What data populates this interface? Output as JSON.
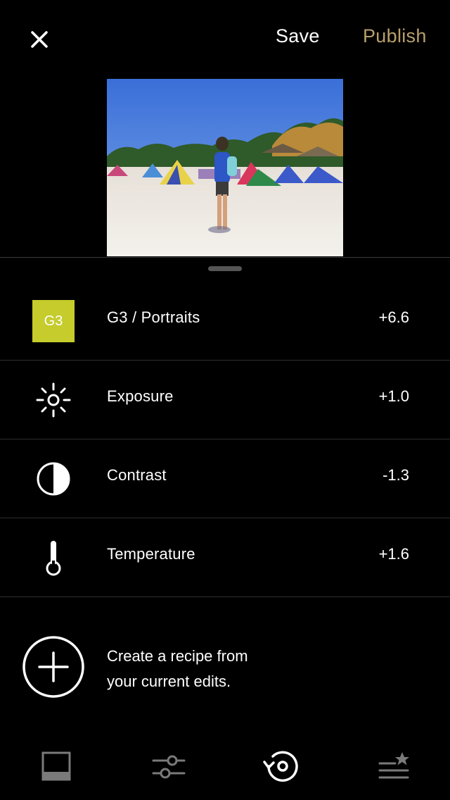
{
  "header": {
    "close_icon": "close-icon",
    "save_label": "Save",
    "publish_label": "Publish",
    "publish_color": "#b8a06a"
  },
  "edits": [
    {
      "icon": "preset-badge",
      "badge": "G3",
      "badge_color": "#c5cc2c",
      "label": "G3 / Portraits",
      "value": "+6.6"
    },
    {
      "icon": "exposure-icon",
      "label": "Exposure",
      "value": "+1.0"
    },
    {
      "icon": "contrast-icon",
      "label": "Contrast",
      "value": "-1.3"
    },
    {
      "icon": "temperature-icon",
      "label": "Temperature",
      "value": "+1.6"
    }
  ],
  "recipe": {
    "icon": "add-circle-icon",
    "line1": "Create a recipe from",
    "line2": "your current edits."
  },
  "tabs": [
    {
      "icon": "presets-icon",
      "active": false
    },
    {
      "icon": "tools-icon",
      "active": false
    },
    {
      "icon": "history-icon",
      "active": true
    },
    {
      "icon": "recipes-icon",
      "active": false
    }
  ]
}
